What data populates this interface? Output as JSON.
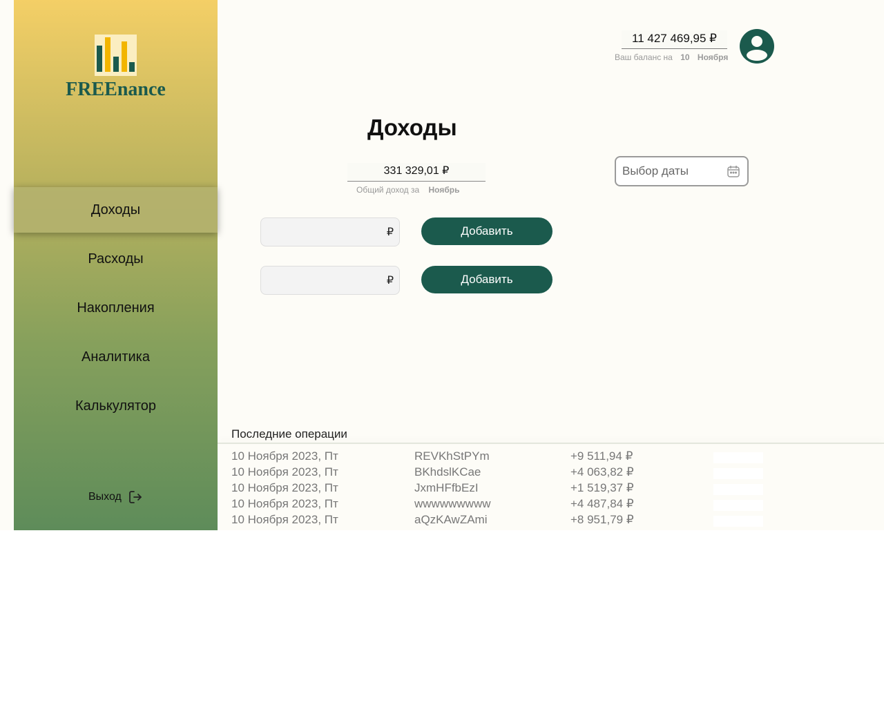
{
  "app": {
    "brand": "FREEnance"
  },
  "colors": {
    "accent": "#1b5a4d",
    "logo_bars": [
      "#1b5a4d",
      "#f2b500"
    ]
  },
  "sidebar": {
    "items": [
      {
        "label": "Доходы",
        "active": true
      },
      {
        "label": "Расходы"
      },
      {
        "label": "Накопления"
      },
      {
        "label": "Аналитика"
      },
      {
        "label": "Калькулятор"
      }
    ],
    "logout_label": "Выход"
  },
  "header": {
    "balance": "11 427 469,95 ₽",
    "balance_caption": "Ваш баланс на",
    "balance_day": "10",
    "balance_month": "Ноября"
  },
  "main": {
    "title": "Доходы",
    "total_income": "331 329,01 ₽",
    "total_caption": "Общий доход за",
    "total_month": "Ноябрь",
    "date_placeholder": "Выбор даты",
    "currency_symbol": "₽",
    "add_label": "Добавить",
    "add_label_2": "Добавить"
  },
  "operations": {
    "title": "Последние операции",
    "rows": [
      {
        "date": "10 Ноября 2023, Пт",
        "name": "REVKhStPYm",
        "amount": "+9 511,94 ₽"
      },
      {
        "date": "10 Ноября 2023, Пт",
        "name": "BKhdslKCae",
        "amount": "+4 063,82 ₽"
      },
      {
        "date": "10 Ноября 2023, Пт",
        "name": "JxmHFfbEzI",
        "amount": "+1 519,37 ₽"
      },
      {
        "date": "10 Ноября 2023, Пт",
        "name": "wwwwwwwww",
        "amount": "+4 487,84 ₽"
      },
      {
        "date": "10 Ноября 2023, Пт",
        "name": "aQzKAwZAmi",
        "amount": "+8 951,79 ₽"
      }
    ]
  }
}
